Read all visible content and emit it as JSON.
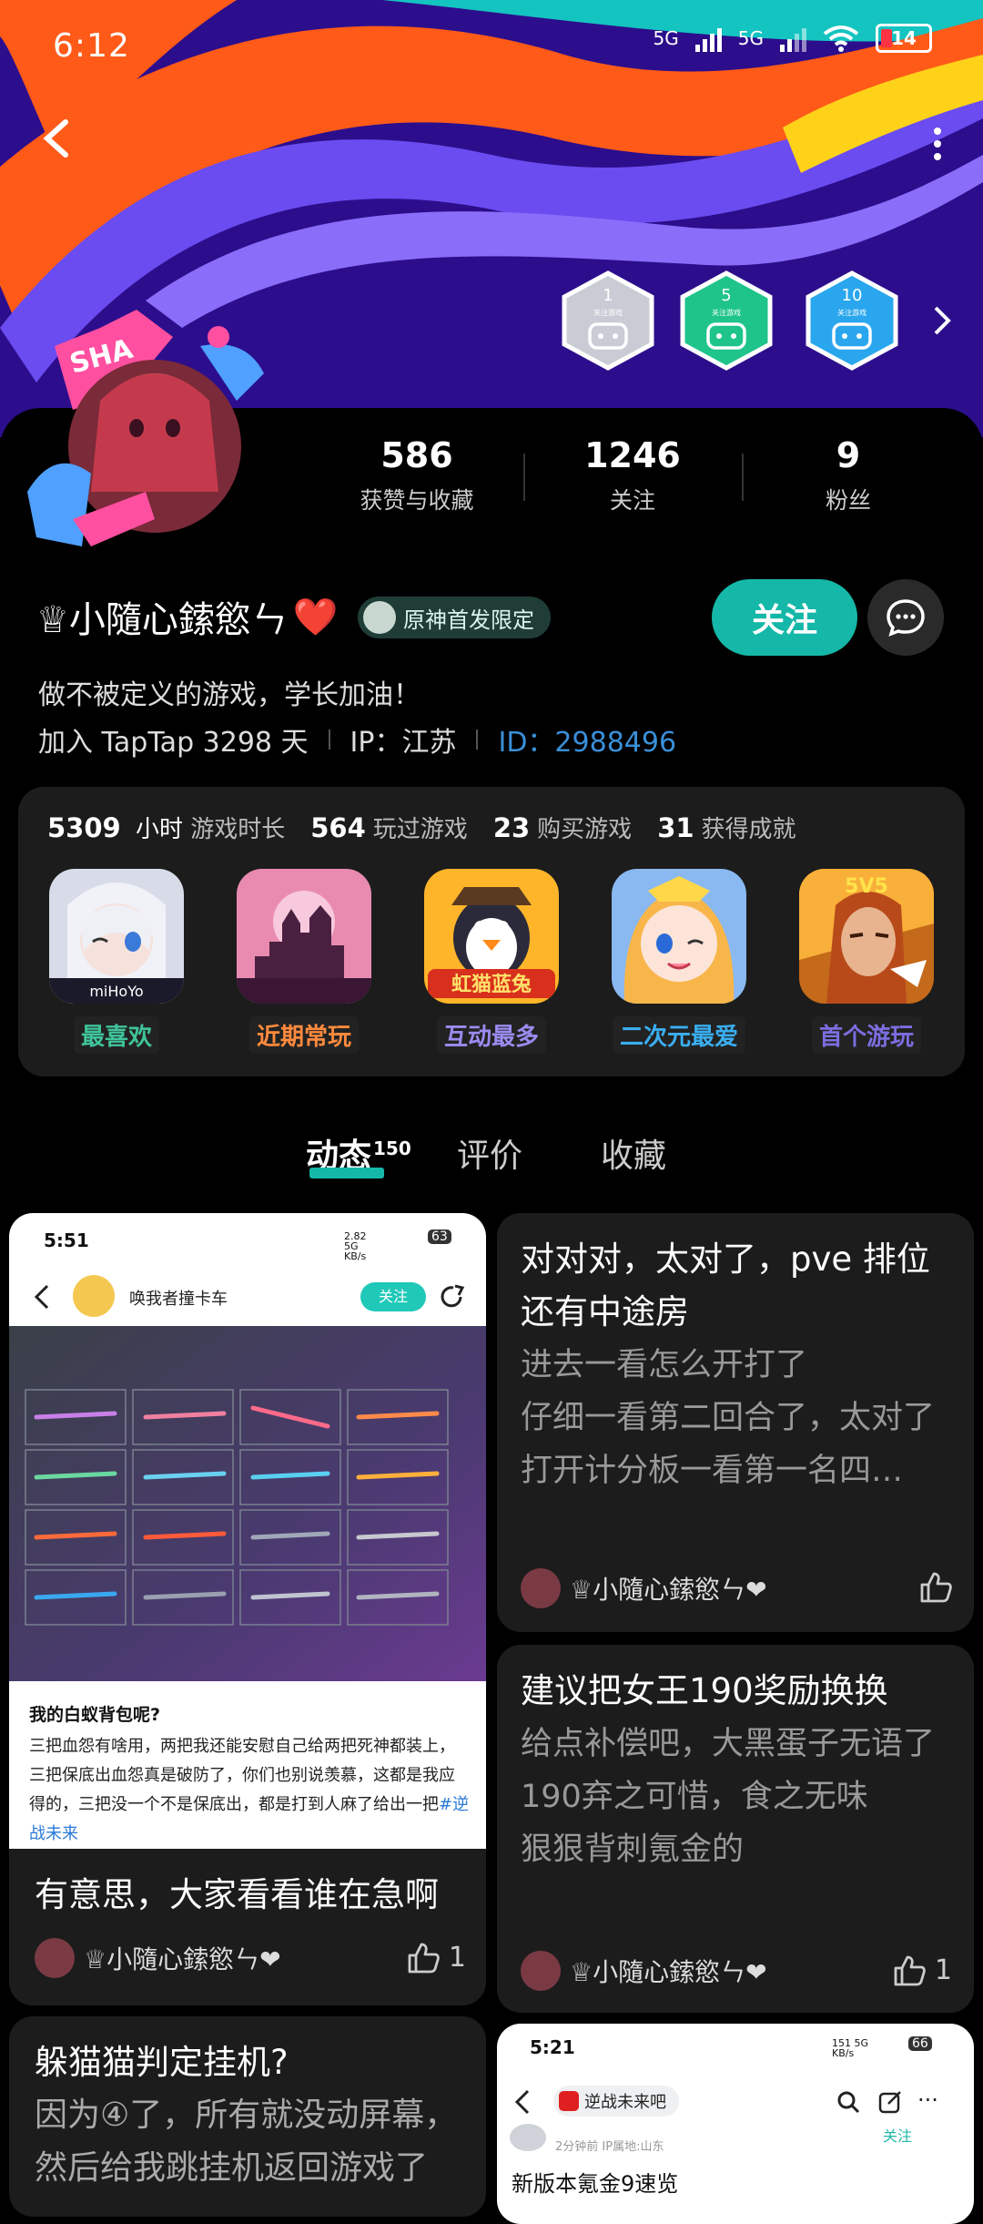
{
  "status_bar": {
    "time": "6:12",
    "network1": "5G",
    "network2": "5G",
    "battery": "14"
  },
  "header": {
    "badges": [
      {
        "num": "1",
        "label": "关注游戏",
        "color": "#c9ccd4"
      },
      {
        "num": "5",
        "label": "关注游戏",
        "color": "#1ec48a"
      },
      {
        "num": "10",
        "label": "关注游戏",
        "color": "#29a6ee"
      }
    ]
  },
  "profile": {
    "stats": [
      {
        "num": "586",
        "label": "获赞与收藏"
      },
      {
        "num": "1246",
        "label": "关注"
      },
      {
        "num": "9",
        "label": "粉丝"
      }
    ],
    "name": "♕小隨心鎍慾ㄣ",
    "heart": "❤️",
    "tag": "原神首发限定",
    "follow_label": "关注",
    "bio": "做不被定义的游戏，学长加油！",
    "join": "加入 TapTap 3298 天",
    "ip": "IP：江苏",
    "id": "ID：2988496"
  },
  "game_card": {
    "stats": [
      {
        "num": "5309",
        "unit": " 小时",
        "label": " 游戏时长"
      },
      {
        "num": "564",
        "unit": "",
        "label": "玩过游戏"
      },
      {
        "num": "23",
        "unit": "",
        "label": "购买游戏"
      },
      {
        "num": "31",
        "unit": "",
        "label": "获得成就"
      }
    ],
    "games": [
      {
        "label": "最喜欢",
        "color": "#3fc49a"
      },
      {
        "label": "近期常玩",
        "color": "#ff8a3d"
      },
      {
        "label": "互动最多",
        "color": "#9a8cf0"
      },
      {
        "label": "二次元最爱",
        "color": "#3aaef0"
      },
      {
        "label": "首个游玩",
        "color": "#7a6ee0"
      }
    ],
    "game_text": {
      "mihoyo": "miHoYo",
      "honkai": "虹猫蓝兔",
      "fivev5": "5V5"
    }
  },
  "tabs": {
    "dynamic": "动态",
    "dynamic_count": "150",
    "review": "评价",
    "collect": "收藏"
  },
  "feed": {
    "card1": {
      "shot_time": "5:51",
      "shot_speed": "2.82 5G KB/s",
      "shot_battery": "63",
      "shot_user": "唤我者撞卡车",
      "shot_follow": "关注",
      "shot_title": "我的白蚁背包呢?",
      "shot_body": "三把血怨有啥用，两把我还能安慰自己给两把死神都装上，三把保底出血怨真是破防了，你们也别说羡慕，这都是我应得的，三把没一个不是保底出，都是打到人麻了给出一把",
      "shot_hashtag": "#逆战未来",
      "title": "有意思，大家看看谁在急啊",
      "author": "♕小隨心鎍慾ㄣ❤",
      "likes": "1"
    },
    "card2": {
      "title": "对对对，太对了，pve 排位还有中途房",
      "body": "进去一看怎么开打了\n仔细一看第二回合了，太对了\n打开计分板一看第一名四…",
      "author": "♕小隨心鎍慾ㄣ❤"
    },
    "card3": {
      "title": "建议把女王190奖励换换",
      "body": "给点补偿吧，大黑蛋子无语了\n190弃之可惜，食之无味\n狠狠背刺氪金的",
      "author": "♕小隨心鎍慾ㄣ❤",
      "likes": "1"
    },
    "card4": {
      "title": "躲猫猫判定挂机?",
      "body": "因为④了，所有就没动屏幕，然后给我跳挂机返回游戏了"
    },
    "card5": {
      "shot_time": "5:21",
      "shot_speed": "151 5G KB/s",
      "shot_battery": "66",
      "shot_game": "逆战未来吧",
      "shot_meta": "2分钟前  IP属地:山东",
      "shot_follow": "关注",
      "shot_title": "新版本氪金9速览"
    }
  },
  "colors": {
    "accent": "#15b8a8",
    "id_blue": "#3a8fd8"
  }
}
